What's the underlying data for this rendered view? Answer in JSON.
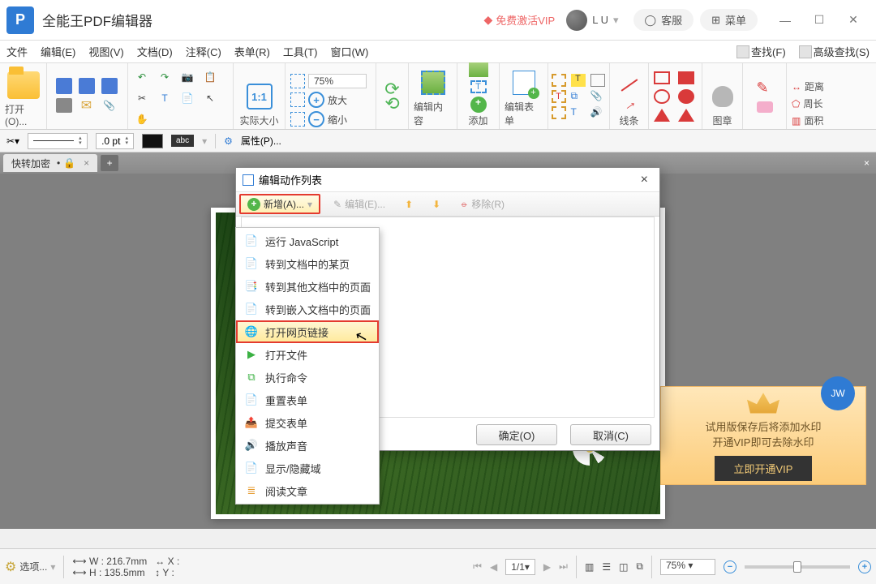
{
  "titlebar": {
    "app_name": "全能王PDF编辑器",
    "vip_text": "免费激活VIP",
    "user_name": "L U",
    "service_text": "客服",
    "menu_text": "菜单"
  },
  "menubar": {
    "items": [
      "文件",
      "编辑(E)",
      "视图(V)",
      "文档(D)",
      "注释(C)",
      "表单(R)",
      "工具(T)",
      "窗口(W)"
    ],
    "right": {
      "find": "查找(F)",
      "adv_find": "高级查找(S)"
    }
  },
  "ribbon": {
    "open": "打开(O)...",
    "real_size": "实际大小",
    "zoom_pct": "75%",
    "zoom_in": "放大",
    "zoom_out": "缩小",
    "edit_content": "编辑内容",
    "add": "添加",
    "edit_form": "编辑表单",
    "lines": "线条",
    "image": "图章",
    "distance": "距离",
    "perimeter": "周长",
    "area": "面积"
  },
  "propbar": {
    "pt": ".0 pt",
    "abc": "abc",
    "prop_label": "属性(P)..."
  },
  "tabstrip": {
    "tab1": "快转加密"
  },
  "dialog": {
    "title": "编辑动作列表",
    "add_btn": "新增(A)...",
    "edit_btn": "编辑(E)...",
    "remove_btn": "移除(R)",
    "ok": "确定(O)",
    "cancel": "取消(C)"
  },
  "dropdown": {
    "items": [
      "运行 JavaScript",
      "转到文档中的某页",
      "转到其他文档中的页面",
      "转到嵌入文档中的页面",
      "打开网页链接",
      "打开文件",
      "执行命令",
      "重置表单",
      "提交表单",
      "播放声音",
      "显示/隐藏域",
      "阅读文章"
    ],
    "selected_index": 4
  },
  "watermark": {
    "line1": "试用版保存后将添加水印",
    "line2": "开通VIP即可去除水印",
    "btn": "立即开通VIP"
  },
  "statusbar": {
    "options": "选项...",
    "w": "W : 216.7mm",
    "h": "H : 135.5mm",
    "x": "X :",
    "y": "Y :",
    "page": "1/1",
    "zoom": "75%"
  },
  "badge": "JW"
}
